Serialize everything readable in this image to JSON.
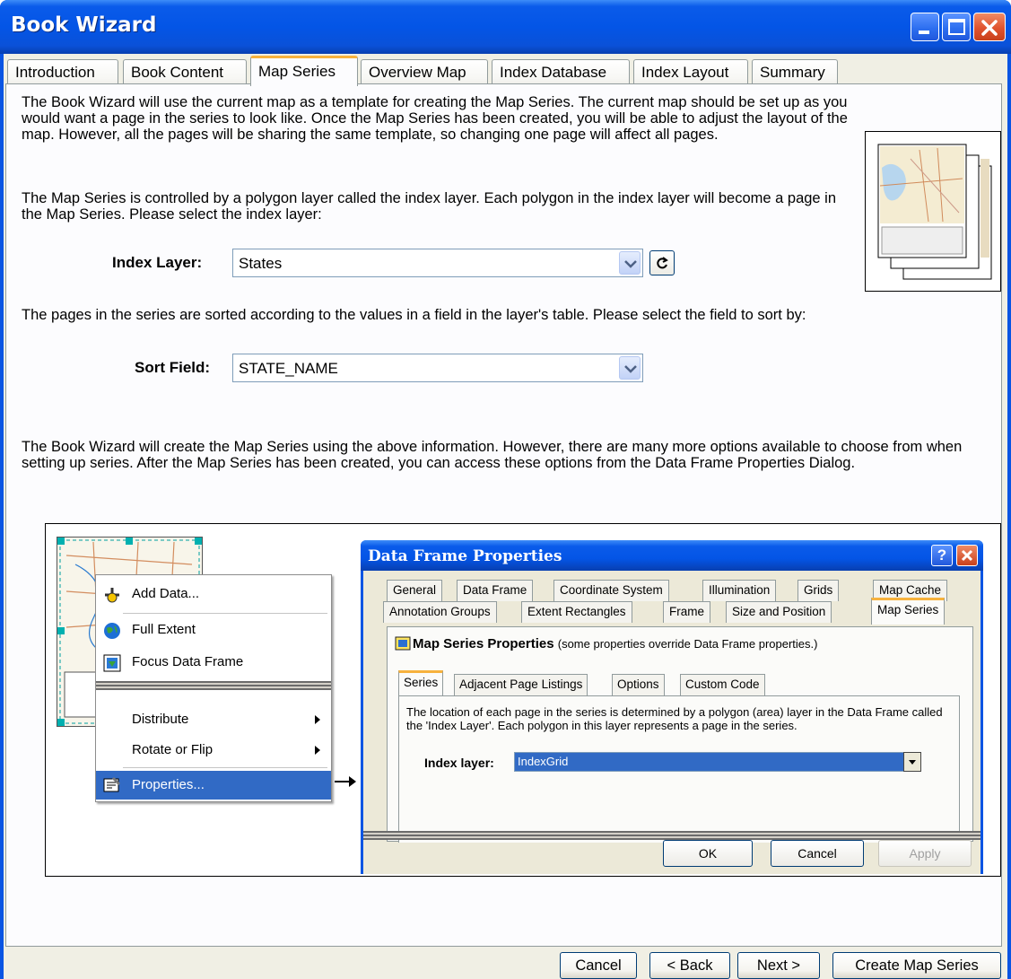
{
  "window": {
    "title": "Book Wizard"
  },
  "tabs": [
    {
      "label": "Introduction"
    },
    {
      "label": "Book Content"
    },
    {
      "label": "Map Series"
    },
    {
      "label": "Overview Map"
    },
    {
      "label": "Index Database"
    },
    {
      "label": "Index Layout"
    },
    {
      "label": "Summary"
    }
  ],
  "active_tab": "Map Series",
  "content": {
    "para1": "The Book Wizard will use the current map as a template for creating the Map Series.  The current map should be set up as you would want a page in the series to look like.  Once the Map Series has been created, you will be able to adjust the layout of the map.  However, all the pages will be sharing the same template, so changing one page will affect all pages.",
    "para2": "The Map Series is controlled by a polygon layer called the index layer.  Each polygon in the index layer will become a page in the Map Series.  Please select the index layer:",
    "index_layer_label": "Index Layer:",
    "index_layer_value": "States",
    "para3": "The pages in the series are sorted according to the values in a field in the layer's table.  Please select the field to sort by:",
    "sort_field_label": "Sort Field:",
    "sort_field_value": "STATE_NAME",
    "para4": "The Book Wizard will create the Map Series using the above information.  However, there are many more options available to choose from when setting up series.  After the Map Series has been created, you can access these options from the Data Frame Properties Dialog."
  },
  "illustration": {
    "context_menu": [
      {
        "label": "Add Data...",
        "icon": "add-data-icon"
      },
      {
        "label": "Full Extent",
        "icon": "globe-icon"
      },
      {
        "label": "Focus Data Frame",
        "icon": "focus-frame-icon"
      },
      {
        "label": "Distribute",
        "submenu": true
      },
      {
        "label": "Rotate or Flip",
        "submenu": true
      },
      {
        "label": "Properties...",
        "icon": "properties-icon",
        "selected": true
      }
    ],
    "dialog": {
      "title": "Data Frame Properties",
      "tabs_row1": [
        "General",
        "Data Frame",
        "Coordinate System",
        "Illumination",
        "Grids",
        "Map Cache"
      ],
      "tabs_row2": [
        "Annotation Groups",
        "Extent Rectangles",
        "Frame",
        "Size and Position",
        "Map Series"
      ],
      "heading": "Map Series Properties",
      "heading_note": "(some properties override Data Frame properties.)",
      "inner_tabs": [
        "Series",
        "Adjacent Page Listings",
        "Options",
        "Custom Code"
      ],
      "description": "The location of each page in the series is determined by a polygon (area) layer in the Data Frame called the 'Index Layer'.  Each polygon in this layer represents a page in the series.",
      "index_layer_label": "Index layer:",
      "index_layer_value": "IndexGrid",
      "ok": "OK",
      "cancel": "Cancel",
      "apply": "Apply"
    }
  },
  "footer": {
    "cancel": "Cancel",
    "back": "< Back",
    "next": "Next >",
    "create": "Create Map Series"
  },
  "colors": {
    "titlebar": "#0455e6",
    "active_tab_accent": "#f7b23d",
    "selection": "#316ac5"
  }
}
